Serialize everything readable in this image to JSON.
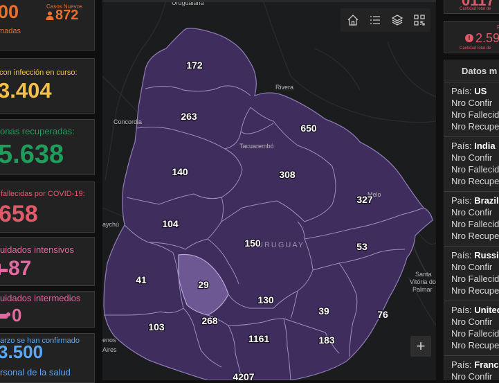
{
  "stats": {
    "confirmed_value": "00",
    "confirmed_label": "madas",
    "new_cases_label": "Casos Nuevos",
    "new_cases_value": "872",
    "active_label": "con infección en curso:",
    "active_value": "3.404",
    "recovered_label": "onas recuperadas:",
    "recovered_value": "5.638",
    "deceased_label": "fallecidas por COVID-19:",
    "deceased_value": "658",
    "icu_label": "uidados intensivos",
    "icu_value": "87",
    "intermediate_label": "uidados intermedios",
    "intermediate_value": "0",
    "health_top": "arzo se han confirmado",
    "health_value": "3.500",
    "health_label": "rsonal de la salud"
  },
  "right_top": {
    "value1": "0117",
    "label1": "Cantidad total de",
    "prefix2": "F",
    "value2": "2.59",
    "label2": "Cantidad total de"
  },
  "map": {
    "toolbar_icons": [
      "home-icon",
      "list-icon",
      "layers-icon",
      "qr-code-icon"
    ],
    "zoom_in_label": "+",
    "place_labels": {
      "uruguaiana": "Uruguaiana",
      "rivera": "Rivera",
      "concordia": "Concordia",
      "tacuarembo": "Tacuarembó",
      "melo": "Melo",
      "uruguay": "URUGUAY",
      "gualeguaychu": "aychú",
      "santa": "Santa",
      "vitoria": "Vitória do",
      "palmar": "Palmar",
      "buenos1": "enos",
      "buenos2": "Aires"
    },
    "department_counts": {
      "artigas": "172",
      "salto": "263",
      "rivera": "650",
      "paysandu": "140",
      "tacuarembo": "308",
      "cerro_largo": "327",
      "rio_negro": "104",
      "durazno": "150",
      "treinta_y_tres": "53",
      "soriano": "41",
      "flores": "29",
      "florida": "130",
      "lavalleja": "39",
      "rocha": "76",
      "colonia": "103",
      "san_jose": "268",
      "canelones": "1161",
      "maldonado": "183",
      "montevideo": "4207"
    }
  },
  "table": {
    "title": "Datos m",
    "rows": [
      {
        "country_label": "País:",
        "country": "US",
        "confirmed": "Nro Confir",
        "deceased": "Nro Fallecid",
        "recovered": "Nro Recupe"
      },
      {
        "country_label": "País:",
        "country": "India",
        "confirmed": "Nro Confir",
        "deceased": "Nro Fallecid",
        "recovered": "Nro Recupe"
      },
      {
        "country_label": "País:",
        "country": "Brazil",
        "confirmed": "Nro Confir",
        "deceased": "Nro Fallecid",
        "recovered": "Nro Recupe"
      },
      {
        "country_label": "País:",
        "country": "Russia",
        "confirmed": "Nro Confir",
        "deceased": "Nro Fallecid",
        "recovered": "Nro Recupe"
      },
      {
        "country_label": "País:",
        "country": "United",
        "confirmed": "Nro Confir",
        "deceased": "Nro Fallecid",
        "recovered": "Nro Recupe"
      },
      {
        "country_label": "País:",
        "country": "France",
        "confirmed": "Nro Confir"
      }
    ]
  },
  "colors": {
    "confirmed": "#e8702a",
    "active": "#f5c04a",
    "recovered": "#1f9d5b",
    "deceased": "#e05a6a",
    "icu": "#e26aa2",
    "health": "#5ba8f5",
    "map_region": "#3f2d5e",
    "map_region_highlight": "#6e5894"
  }
}
